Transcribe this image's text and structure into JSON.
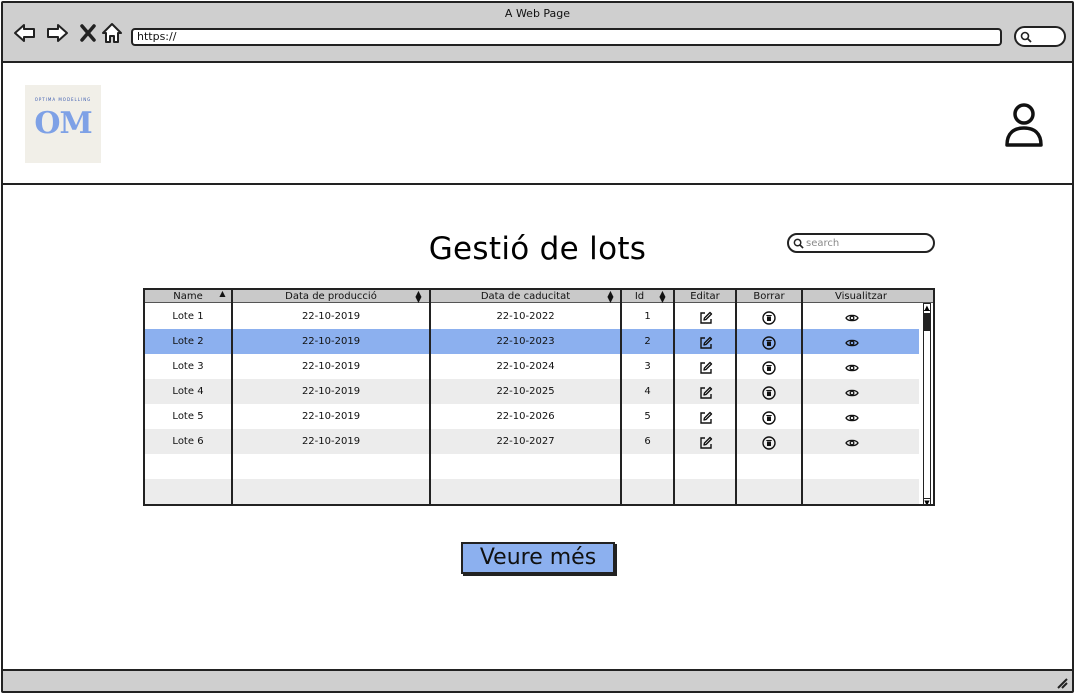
{
  "browser": {
    "title": "A Web Page",
    "url": "https://"
  },
  "icons": {
    "back": "arrow-left-icon",
    "forward": "arrow-right-icon",
    "stop": "close-icon",
    "home": "home-icon",
    "browser_search": "search-icon",
    "user": "user-icon",
    "edit": "edit-icon",
    "delete": "trash-icon",
    "view": "eye-icon"
  },
  "logo": {
    "mark": "OM",
    "sub": "OPTIMA MODELLING"
  },
  "page": {
    "title": "Gestió de lots"
  },
  "search": {
    "placeholder": "search"
  },
  "table": {
    "columns": [
      "Name",
      "Data de producció",
      "Data de caducitat",
      "Id",
      "Editar",
      "Borrar",
      "Visualitzar"
    ],
    "selected_row": 1,
    "rows": [
      {
        "name": "Lote 1",
        "produccio": "22-10-2019",
        "caducitat": "22-10-2022",
        "id": "1"
      },
      {
        "name": "Lote 2",
        "produccio": "22-10-2019",
        "caducitat": "22-10-2023",
        "id": "2"
      },
      {
        "name": "Lote 3",
        "produccio": "22-10-2019",
        "caducitat": "22-10-2024",
        "id": "3"
      },
      {
        "name": "Lote 4",
        "produccio": "22-10-2019",
        "caducitat": "22-10-2025",
        "id": "4"
      },
      {
        "name": "Lote 5",
        "produccio": "22-10-2019",
        "caducitat": "22-10-2026",
        "id": "5"
      },
      {
        "name": "Lote 6",
        "produccio": "22-10-2019",
        "caducitat": "22-10-2027",
        "id": "6"
      }
    ]
  },
  "actions": {
    "more_label": "Veure més"
  },
  "colors": {
    "accent": "#8cb0ef",
    "chrome": "#cfcfcf",
    "row_alt": "#ececec",
    "header": "#c9c9c9"
  }
}
